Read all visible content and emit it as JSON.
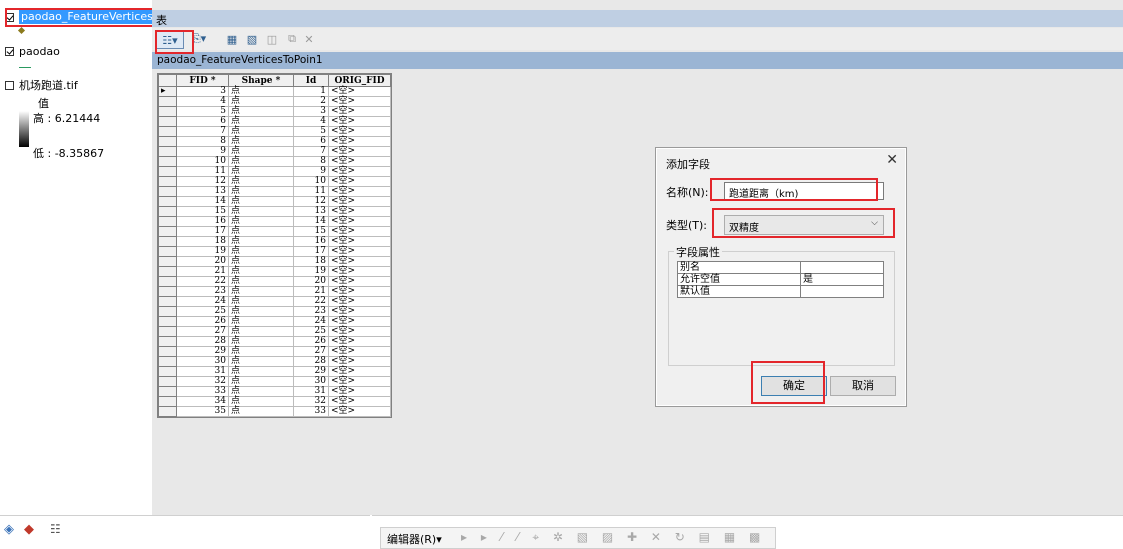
{
  "toc": {
    "layers": [
      {
        "name": "paodao_FeatureVerticesTo",
        "checked": true,
        "selected": true
      },
      {
        "name": "paodao",
        "checked": true
      },
      {
        "name": "机场跑道.tif",
        "checked": false
      }
    ],
    "legend": {
      "value_label": "值",
      "high": "高 : 6.21444",
      "low": "低 : -8.35867"
    }
  },
  "table_window": {
    "title": "表",
    "tab": "paodao_FeatureVerticesToPoin1",
    "columns": [
      "FID *",
      "Shape *",
      "Id",
      "ORIG_FID"
    ],
    "rows": [
      [
        "3",
        "点",
        "1",
        "<空>"
      ],
      [
        "4",
        "点",
        "2",
        "<空>"
      ],
      [
        "5",
        "点",
        "3",
        "<空>"
      ],
      [
        "6",
        "点",
        "4",
        "<空>"
      ],
      [
        "7",
        "点",
        "5",
        "<空>"
      ],
      [
        "8",
        "点",
        "6",
        "<空>"
      ],
      [
        "9",
        "点",
        "7",
        "<空>"
      ],
      [
        "10",
        "点",
        "8",
        "<空>"
      ],
      [
        "11",
        "点",
        "9",
        "<空>"
      ],
      [
        "12",
        "点",
        "10",
        "<空>"
      ],
      [
        "13",
        "点",
        "11",
        "<空>"
      ],
      [
        "14",
        "点",
        "12",
        "<空>"
      ],
      [
        "15",
        "点",
        "13",
        "<空>"
      ],
      [
        "16",
        "点",
        "14",
        "<空>"
      ],
      [
        "17",
        "点",
        "15",
        "<空>"
      ],
      [
        "18",
        "点",
        "16",
        "<空>"
      ],
      [
        "19",
        "点",
        "17",
        "<空>"
      ],
      [
        "20",
        "点",
        "18",
        "<空>"
      ],
      [
        "21",
        "点",
        "19",
        "<空>"
      ],
      [
        "22",
        "点",
        "20",
        "<空>"
      ],
      [
        "23",
        "点",
        "21",
        "<空>"
      ],
      [
        "24",
        "点",
        "22",
        "<空>"
      ],
      [
        "25",
        "点",
        "23",
        "<空>"
      ],
      [
        "26",
        "点",
        "24",
        "<空>"
      ],
      [
        "27",
        "点",
        "25",
        "<空>"
      ],
      [
        "28",
        "点",
        "26",
        "<空>"
      ],
      [
        "29",
        "点",
        "27",
        "<空>"
      ],
      [
        "30",
        "点",
        "28",
        "<空>"
      ],
      [
        "31",
        "点",
        "29",
        "<空>"
      ],
      [
        "32",
        "点",
        "30",
        "<空>"
      ],
      [
        "33",
        "点",
        "31",
        "<空>"
      ],
      [
        "34",
        "点",
        "32",
        "<空>"
      ],
      [
        "35",
        "点",
        "33",
        "<空>"
      ]
    ]
  },
  "dialog": {
    "title": "添加字段",
    "close": "✕",
    "name_label": "名称(N):",
    "name_value": "跑道距离（km)",
    "type_label": "类型(T):",
    "type_value": "双精度",
    "props_caption": "字段属性",
    "props": [
      {
        "key": "别名",
        "value": ""
      },
      {
        "key": "允许空值",
        "value": "是"
      },
      {
        "key": "默认值",
        "value": ""
      }
    ],
    "ok": "确定",
    "cancel": "取消"
  },
  "editor": {
    "menu": "编辑器(R)▾"
  }
}
